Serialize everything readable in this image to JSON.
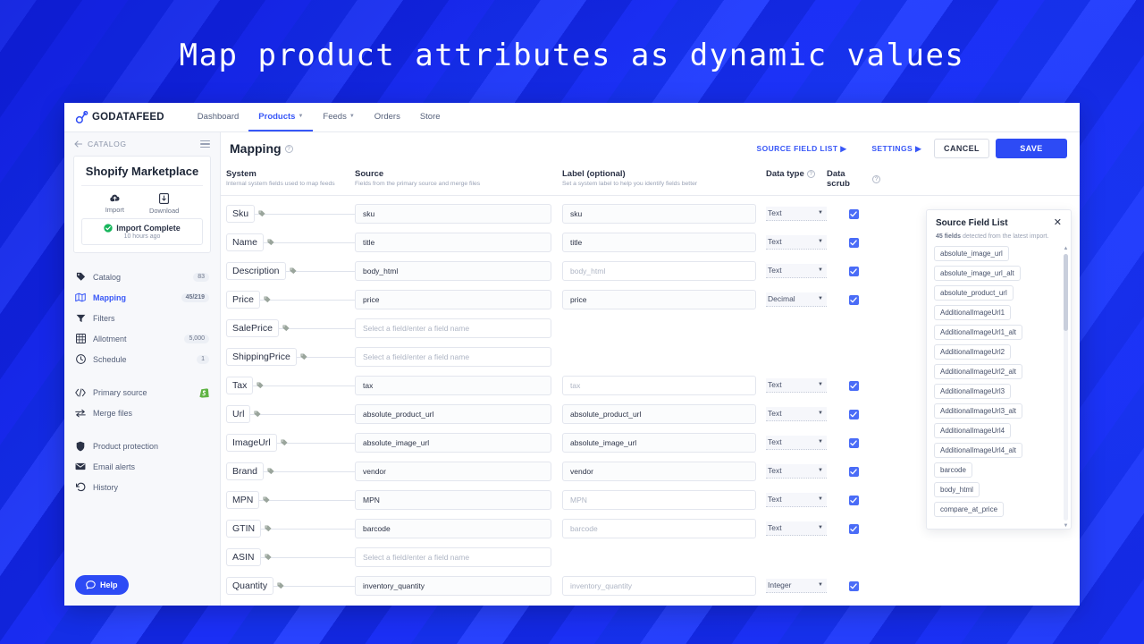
{
  "slide": {
    "headline": "Map product attributes as dynamic values",
    "accent_blue": "#2d4bf5",
    "background_blue": "#1b2ff5"
  },
  "topnav": {
    "brand": "GODATAFEED",
    "items": [
      {
        "label": "Dashboard",
        "has_caret": false,
        "active": false
      },
      {
        "label": "Products",
        "has_caret": true,
        "active": true
      },
      {
        "label": "Feeds",
        "has_caret": true,
        "active": false
      },
      {
        "label": "Orders",
        "has_caret": false,
        "active": false
      },
      {
        "label": "Store",
        "has_caret": false,
        "active": false
      }
    ]
  },
  "sidebar": {
    "back_label": "CATALOG",
    "card": {
      "title": "Shopify Marketplace",
      "actions": [
        {
          "label": "Import",
          "icon": "cloud-upload-icon"
        },
        {
          "label": "Download",
          "icon": "file-download-icon"
        }
      ],
      "status": "Import Complete",
      "status_time": "10 hours ago"
    },
    "groups": [
      {
        "items": [
          {
            "label": "Catalog",
            "icon": "tag-icon",
            "badge": "83",
            "active": false
          },
          {
            "label": "Mapping",
            "icon": "map-icon",
            "badge": "45/219",
            "active": true
          },
          {
            "label": "Filters",
            "icon": "funnel-icon",
            "badge": "",
            "active": false
          },
          {
            "label": "Allotment",
            "icon": "grid-icon",
            "badge": "5,000",
            "active": false
          },
          {
            "label": "Schedule",
            "icon": "clock-icon",
            "badge": "1",
            "active": false
          }
        ]
      },
      {
        "items": [
          {
            "label": "Primary source",
            "icon": "code-icon",
            "badge": "",
            "shopify": true,
            "active": false
          },
          {
            "label": "Merge files",
            "icon": "merge-icon",
            "badge": "",
            "active": false
          }
        ]
      },
      {
        "items": [
          {
            "label": "Product protection",
            "icon": "shield-icon",
            "badge": "",
            "active": false
          },
          {
            "label": "Email alerts",
            "icon": "envelope-icon",
            "badge": "",
            "active": false
          },
          {
            "label": "History",
            "icon": "history-icon",
            "badge": "",
            "active": false
          }
        ]
      }
    ],
    "help_label": "Help"
  },
  "main": {
    "page_title": "Mapping",
    "actions": {
      "source_field_list": "SOURCE FIELD LIST",
      "settings": "SETTINGS",
      "cancel": "CANCEL",
      "save": "SAVE"
    },
    "columns": [
      {
        "title": "System",
        "sub": "Internal system fields used to map feeds"
      },
      {
        "title": "Source",
        "sub": "Fields from the primary source and merge files"
      },
      {
        "title": "Label (optional)",
        "sub": "Set a system label to help you identify fields better"
      },
      {
        "title": "Data type",
        "sub": ""
      },
      {
        "title": "Data scrub",
        "sub": ""
      }
    ],
    "source_placeholder": "Select a field/enter a field name",
    "rows": [
      {
        "system": "Sku",
        "source": "sku",
        "source_empty": false,
        "label": "sku",
        "label_empty": false,
        "dtype": "Text",
        "scrub": true
      },
      {
        "system": "Name",
        "source": "title",
        "source_empty": false,
        "label": "title",
        "label_empty": false,
        "dtype": "Text",
        "scrub": true
      },
      {
        "system": "Description",
        "source": "body_html",
        "source_empty": false,
        "label": "body_html",
        "label_empty": true,
        "dtype": "Text",
        "scrub": true
      },
      {
        "system": "Price",
        "source": "price",
        "source_empty": false,
        "label": "price",
        "label_empty": false,
        "dtype": "Decimal",
        "scrub": true
      },
      {
        "system": "SalePrice",
        "source": "",
        "source_empty": true,
        "label": "",
        "label_empty": true,
        "dtype": "",
        "scrub": false
      },
      {
        "system": "ShippingPrice",
        "source": "",
        "source_empty": true,
        "label": "",
        "label_empty": true,
        "dtype": "",
        "scrub": false
      },
      {
        "system": "Tax",
        "source": "tax",
        "source_empty": false,
        "label": "tax",
        "label_empty": true,
        "dtype": "Text",
        "scrub": true
      },
      {
        "system": "Url",
        "source": "absolute_product_url",
        "source_empty": false,
        "label": "absolute_product_url",
        "label_empty": false,
        "dtype": "Text",
        "scrub": true
      },
      {
        "system": "ImageUrl",
        "source": "absolute_image_url",
        "source_empty": false,
        "label": "absolute_image_url",
        "label_empty": false,
        "dtype": "Text",
        "scrub": true
      },
      {
        "system": "Brand",
        "source": "vendor",
        "source_empty": false,
        "label": "vendor",
        "label_empty": false,
        "dtype": "Text",
        "scrub": true
      },
      {
        "system": "MPN",
        "source": "MPN",
        "source_empty": false,
        "label": "MPN",
        "label_empty": true,
        "dtype": "Text",
        "scrub": true
      },
      {
        "system": "GTIN",
        "source": "barcode",
        "source_empty": false,
        "label": "barcode",
        "label_empty": true,
        "dtype": "Text",
        "scrub": true
      },
      {
        "system": "ASIN",
        "source": "",
        "source_empty": true,
        "label": "",
        "label_empty": true,
        "dtype": "",
        "scrub": false
      },
      {
        "system": "Quantity",
        "source": "inventory_quantity",
        "source_empty": false,
        "label": "inventory_quantity",
        "label_empty": true,
        "dtype": "Integer",
        "scrub": true
      }
    ]
  },
  "source_field_list": {
    "title": "Source Field List",
    "count_bold": "45 fields",
    "count_rest": " detected from the latest import.",
    "fields": [
      "absolute_image_url",
      "absolute_image_url_alt",
      "absolute_product_url",
      "AdditionalImageUrl1",
      "AdditionalImageUrl1_alt",
      "AdditionalImageUrl2",
      "AdditionalImageUrl2_alt",
      "AdditionalImageUrl3",
      "AdditionalImageUrl3_alt",
      "AdditionalImageUrl4",
      "AdditionalImageUrl4_alt",
      "barcode",
      "body_html",
      "compare_at_price"
    ]
  }
}
